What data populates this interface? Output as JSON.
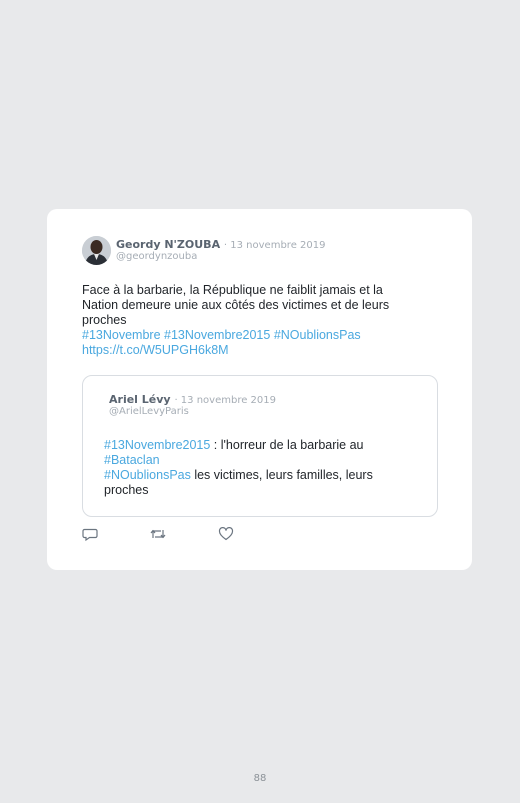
{
  "tweet": {
    "author_name": "Geordy N'ZOUBA",
    "date": "· 13 novembre 2019",
    "handle": "@geordynzouba",
    "text_line1": "Face à la barbarie, la République ne faiblit jamais et la",
    "text_line2": "Nation demeure unie aux côtés des victimes et de leurs",
    "text_line3": "proches",
    "hashtag1": "#13Novembre",
    "hashtag2": "#13Novembre2015",
    "hashtag3": "#NOublionsPas",
    "url": "https://t.co/W5UPGH6k8M"
  },
  "quoted": {
    "author_name": "Ariel Lévy",
    "date": "· 13 novembre 2019",
    "handle": "@ArielLevyParis",
    "hashtag1": "#13Novembre2015",
    "text1": " : l'horreur de la barbarie au",
    "hashtag2": "#Bataclan",
    "hashtag3": "#NOublionsPas",
    "text2": " les victimes, leurs familles, leurs",
    "text3": "proches"
  },
  "actions": {
    "reply_icon": "reply-icon",
    "retweet_icon": "retweet-icon",
    "like_icon": "heart-icon"
  },
  "colors": {
    "link": "#4aa8df",
    "background": "#e8e9eb",
    "card": "#ffffff"
  },
  "page": {
    "number": "88"
  }
}
